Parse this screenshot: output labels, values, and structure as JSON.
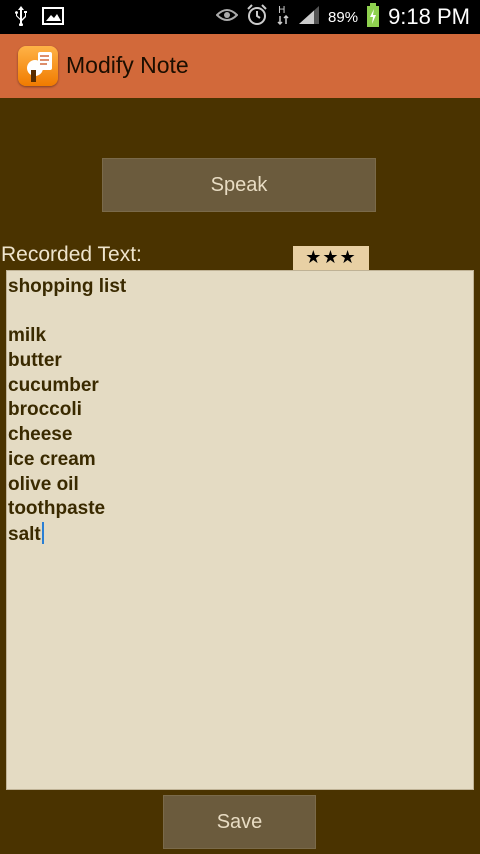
{
  "status_bar": {
    "battery_percent": "89%",
    "time": "9:18 PM",
    "icons": [
      "usb-icon",
      "image-icon",
      "eye-icon",
      "alarm-icon",
      "h-data-icon",
      "signal-icon",
      "battery-icon"
    ]
  },
  "action_bar": {
    "title": "Modify Note",
    "icon": "app-icon"
  },
  "main": {
    "speak_label": "Speak",
    "recorded_label": "Recorded Text:",
    "stars": "★★★",
    "note_lines": [
      "shopping list",
      "",
      "milk",
      "butter",
      "cucumber",
      "broccoli",
      "cheese",
      "ice cream",
      "olive oil",
      "toothpaste",
      "salt"
    ],
    "save_label": "Save"
  },
  "colors": {
    "background": "#4a3300",
    "action_bar": "#d2693a",
    "button": "#6b5b3d",
    "note_bg": "#e4dbc3"
  }
}
